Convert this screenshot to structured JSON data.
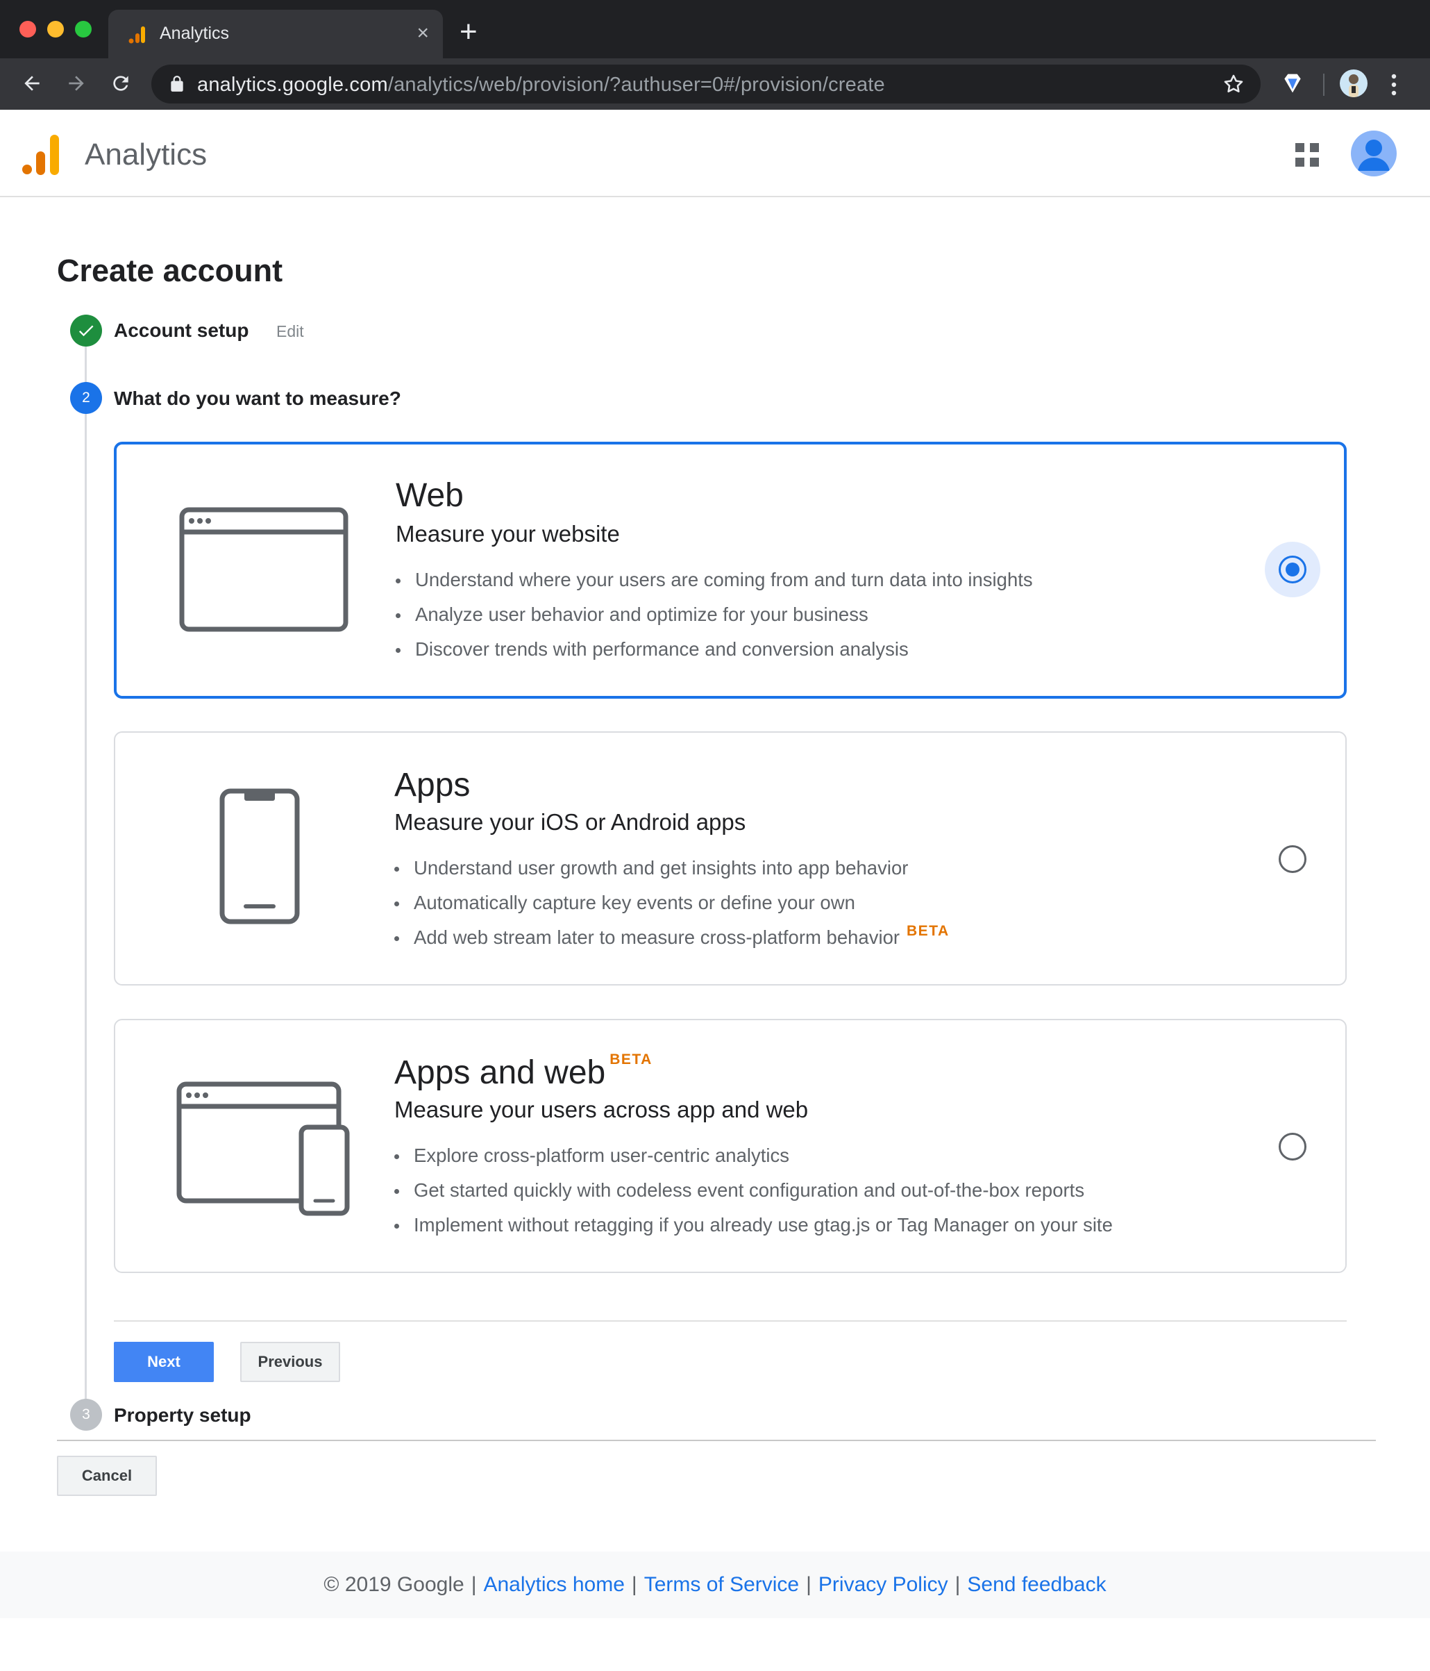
{
  "browser": {
    "tab_title": "Analytics",
    "tab_close": "×",
    "new_tab": "+",
    "url_host": "analytics.google.com",
    "url_path": "/analytics/web/provision/?authuser=0#/provision/create"
  },
  "app": {
    "name": "Analytics",
    "brand_colors": {
      "bar_dark": "#e37400",
      "bar_light": "#f9ab00"
    }
  },
  "page": {
    "title": "Create account"
  },
  "steps": [
    {
      "number": "✓",
      "label": "Account setup",
      "action": "Edit",
      "status": "complete"
    },
    {
      "number": "2",
      "label": "What do you want to measure?",
      "status": "active"
    },
    {
      "number": "3",
      "label": "Property setup",
      "status": "pending"
    }
  ],
  "options": [
    {
      "title": "Web",
      "subtitle": "Measure your website",
      "bullets": [
        "Understand where your users are coming from and turn data into insights",
        "Analyze user behavior and optimize for your business",
        "Discover trends with performance and conversion analysis"
      ],
      "selected": true,
      "icon": "browser-window-icon"
    },
    {
      "title": "Apps",
      "subtitle": "Measure your iOS or Android apps",
      "bullets": [
        "Understand user growth and get insights into app behavior",
        "Automatically capture key events or define your own",
        "Add web stream later to measure cross-platform behavior"
      ],
      "bullet_badge": "BETA",
      "selected": false,
      "icon": "smartphone-icon"
    },
    {
      "title": "Apps and web",
      "title_badge": "BETA",
      "subtitle": "Measure your users across app and web",
      "bullets": [
        "Explore cross-platform user-centric analytics",
        "Get started quickly with codeless event configuration and out-of-the-box reports",
        "Implement without retagging if you already use gtag.js or Tag Manager on your site"
      ],
      "selected": false,
      "icon": "browser-and-phone-icon"
    }
  ],
  "buttons": {
    "next": "Next",
    "previous": "Previous",
    "cancel": "Cancel"
  },
  "footer": {
    "copyright": "© 2019 Google",
    "links": [
      "Analytics home",
      "Terms of Service",
      "Privacy Policy",
      "Send feedback"
    ],
    "separator": "|"
  },
  "colors": {
    "accent": "#1a73e8",
    "button_primary": "#4285f4",
    "success": "#1e8e3e",
    "beta": "#e37400"
  }
}
